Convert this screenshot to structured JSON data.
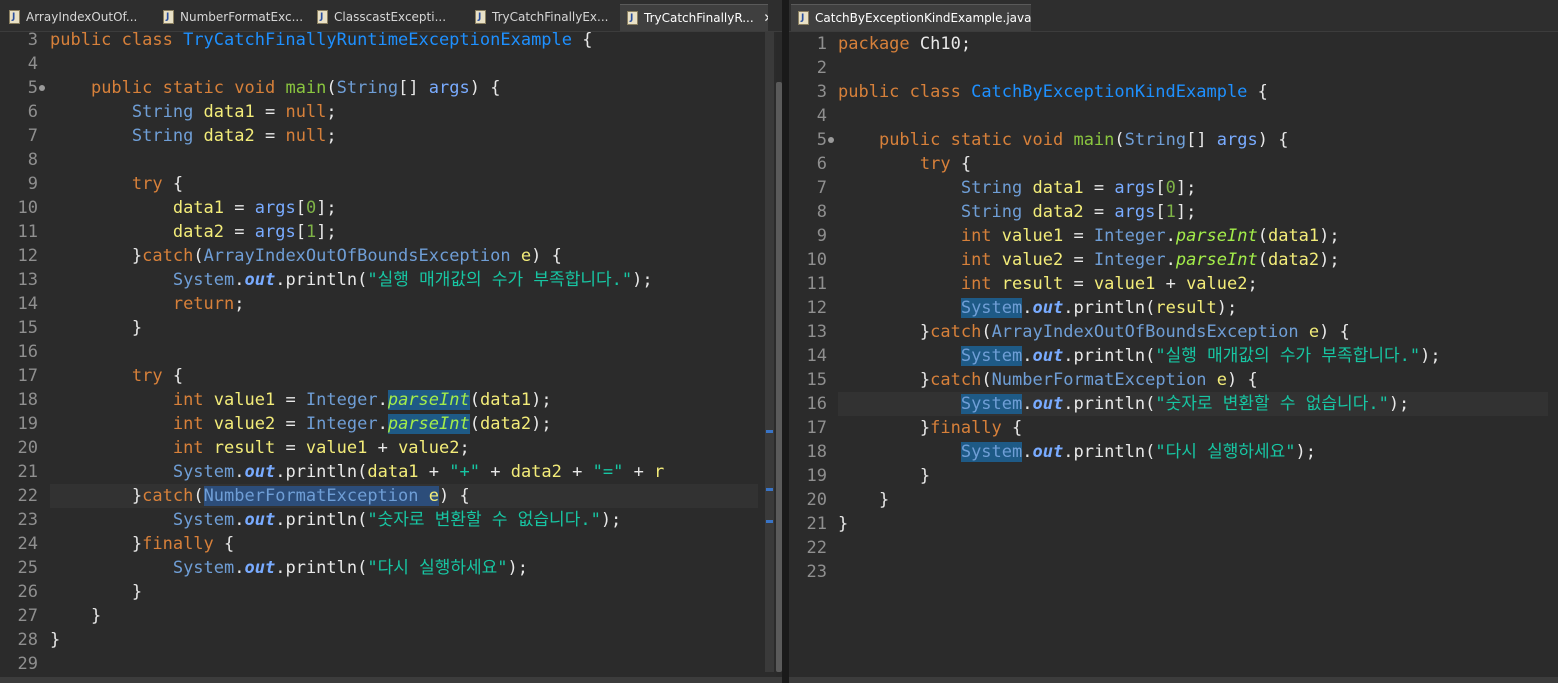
{
  "left_tabs": [
    {
      "label": "ArrayIndexOutOf...",
      "active": false
    },
    {
      "label": "NumberFormatExc...",
      "active": false
    },
    {
      "label": "ClasscastExcepti...",
      "active": false
    },
    {
      "label": "TryCatchFinallyEx...",
      "active": false
    },
    {
      "label": "TryCatchFinallyR...",
      "active": true,
      "close": "✕"
    }
  ],
  "right_tabs": [
    {
      "label": "CatchByExceptionKindExample.java",
      "active": true,
      "close": "✕"
    }
  ],
  "left_editor": {
    "current_line": 22,
    "lines": [
      {
        "n": "3",
        "t": [
          [
            "kw",
            "public "
          ],
          [
            "kw",
            "class "
          ],
          [
            "cls",
            "TryCatchFinallyRuntimeExceptionExample"
          ],
          [
            "op",
            " {"
          ]
        ]
      },
      {
        "n": "4",
        "t": []
      },
      {
        "n": "5",
        "fold": true,
        "t": [
          [
            "op",
            "    "
          ],
          [
            "kw",
            "public "
          ],
          [
            "kw",
            "static "
          ],
          [
            "kw",
            "void "
          ],
          [
            "fn",
            "main"
          ],
          [
            "op",
            "("
          ],
          [
            "ty",
            "String"
          ],
          [
            "op",
            "[] "
          ],
          [
            "st",
            "args"
          ],
          [
            "op",
            ") {"
          ]
        ]
      },
      {
        "n": "6",
        "t": [
          [
            "op",
            "        "
          ],
          [
            "ty",
            "String "
          ],
          [
            "var",
            "data1"
          ],
          [
            "op",
            " = "
          ],
          [
            "kw",
            "null"
          ],
          [
            "op",
            ";"
          ]
        ]
      },
      {
        "n": "7",
        "t": [
          [
            "op",
            "        "
          ],
          [
            "ty",
            "String "
          ],
          [
            "var",
            "data2"
          ],
          [
            "op",
            " = "
          ],
          [
            "kw",
            "null"
          ],
          [
            "op",
            ";"
          ]
        ]
      },
      {
        "n": "8",
        "t": []
      },
      {
        "n": "9",
        "t": [
          [
            "op",
            "        "
          ],
          [
            "kw",
            "try"
          ],
          [
            "op",
            " {"
          ]
        ]
      },
      {
        "n": "10",
        "t": [
          [
            "op",
            "            "
          ],
          [
            "var",
            "data1"
          ],
          [
            "op",
            " = "
          ],
          [
            "st",
            "args"
          ],
          [
            "op",
            "["
          ],
          [
            "num",
            "0"
          ],
          [
            "op",
            "];"
          ]
        ]
      },
      {
        "n": "11",
        "t": [
          [
            "op",
            "            "
          ],
          [
            "var",
            "data2"
          ],
          [
            "op",
            " = "
          ],
          [
            "st",
            "args"
          ],
          [
            "op",
            "["
          ],
          [
            "num",
            "1"
          ],
          [
            "op",
            "];"
          ]
        ]
      },
      {
        "n": "12",
        "t": [
          [
            "op",
            "        }"
          ],
          [
            "kw",
            "catch"
          ],
          [
            "op",
            "("
          ],
          [
            "ty",
            "ArrayIndexOutOfBoundsException"
          ],
          [
            "op",
            " "
          ],
          [
            "var",
            "e"
          ],
          [
            "op",
            ") {"
          ]
        ]
      },
      {
        "n": "13",
        "t": [
          [
            "op",
            "            "
          ],
          [
            "ty",
            "System"
          ],
          [
            "op",
            "."
          ],
          [
            "si",
            "out"
          ],
          [
            "op",
            "."
          ],
          [
            "op",
            "println("
          ],
          [
            "str",
            "\"실행 매개값의 수가 부족합니다.\""
          ],
          [
            "op",
            ");"
          ]
        ]
      },
      {
        "n": "14",
        "t": [
          [
            "op",
            "            "
          ],
          [
            "kw",
            "return"
          ],
          [
            "op",
            ";"
          ]
        ]
      },
      {
        "n": "15",
        "t": [
          [
            "op",
            "        }"
          ]
        ]
      },
      {
        "n": "16",
        "t": []
      },
      {
        "n": "17",
        "t": [
          [
            "op",
            "        "
          ],
          [
            "kw",
            "try"
          ],
          [
            "op",
            " {"
          ]
        ]
      },
      {
        "n": "18",
        "t": [
          [
            "op",
            "            "
          ],
          [
            "kw",
            "int "
          ],
          [
            "var",
            "value1"
          ],
          [
            "op",
            " = "
          ],
          [
            "ty",
            "Integer"
          ],
          [
            "op",
            "."
          ],
          [
            "mcall mk",
            "parseInt"
          ],
          [
            "op",
            "("
          ],
          [
            "var",
            "data1"
          ],
          [
            "op",
            ");"
          ]
        ]
      },
      {
        "n": "19",
        "t": [
          [
            "op",
            "            "
          ],
          [
            "kw",
            "int "
          ],
          [
            "var",
            "value2"
          ],
          [
            "op",
            " = "
          ],
          [
            "ty",
            "Integer"
          ],
          [
            "op",
            "."
          ],
          [
            "mcall mk",
            "parseInt"
          ],
          [
            "op",
            "("
          ],
          [
            "var",
            "data2"
          ],
          [
            "op",
            ");"
          ]
        ]
      },
      {
        "n": "20",
        "t": [
          [
            "op",
            "            "
          ],
          [
            "kw",
            "int "
          ],
          [
            "var",
            "result"
          ],
          [
            "op",
            " = "
          ],
          [
            "var",
            "value1"
          ],
          [
            "op",
            " + "
          ],
          [
            "var",
            "value2"
          ],
          [
            "op",
            ";"
          ]
        ]
      },
      {
        "n": "21",
        "t": [
          [
            "op",
            "            "
          ],
          [
            "ty",
            "System"
          ],
          [
            "op",
            "."
          ],
          [
            "si",
            "out"
          ],
          [
            "op",
            "."
          ],
          [
            "op",
            "println("
          ],
          [
            "var",
            "data1"
          ],
          [
            "op",
            " + "
          ],
          [
            "str",
            "\"+\""
          ],
          [
            "op",
            " + "
          ],
          [
            "var",
            "data2"
          ],
          [
            "op",
            " + "
          ],
          [
            "str",
            "\"=\""
          ],
          [
            "op",
            " + "
          ],
          [
            "var",
            "r"
          ]
        ]
      },
      {
        "n": "22",
        "t": [
          [
            "op",
            "        }"
          ],
          [
            "kw",
            "catch"
          ],
          [
            "op",
            "("
          ],
          [
            "ty mk2",
            "NumberFormatException"
          ],
          [
            "op mk2",
            " "
          ],
          [
            "var mk2",
            "e"
          ],
          [
            "op",
            ") {"
          ]
        ]
      },
      {
        "n": "23",
        "t": [
          [
            "op",
            "            "
          ],
          [
            "ty",
            "System"
          ],
          [
            "op",
            "."
          ],
          [
            "si",
            "out"
          ],
          [
            "op",
            "."
          ],
          [
            "op",
            "println("
          ],
          [
            "str",
            "\"숫자로 변환할 수 없습니다.\""
          ],
          [
            "op",
            ");"
          ]
        ]
      },
      {
        "n": "24",
        "t": [
          [
            "op",
            "        }"
          ],
          [
            "kw",
            "finally"
          ],
          [
            "op",
            " {"
          ]
        ]
      },
      {
        "n": "25",
        "t": [
          [
            "op",
            "            "
          ],
          [
            "ty",
            "System"
          ],
          [
            "op",
            "."
          ],
          [
            "si",
            "out"
          ],
          [
            "op",
            "."
          ],
          [
            "op",
            "println("
          ],
          [
            "str",
            "\"다시 실행하세요\""
          ],
          [
            "op",
            ");"
          ]
        ]
      },
      {
        "n": "26",
        "t": [
          [
            "op",
            "        }"
          ]
        ]
      },
      {
        "n": "27",
        "t": [
          [
            "op",
            "    }"
          ]
        ]
      },
      {
        "n": "28",
        "t": [
          [
            "op",
            "}"
          ]
        ]
      },
      {
        "n": "29",
        "t": []
      }
    ]
  },
  "right_editor": {
    "current_line": 16,
    "lines": [
      {
        "n": "1",
        "t": [
          [
            "kw",
            "package "
          ],
          [
            "op",
            "Ch10;"
          ]
        ]
      },
      {
        "n": "2",
        "t": []
      },
      {
        "n": "3",
        "t": [
          [
            "kw",
            "public "
          ],
          [
            "kw",
            "class "
          ],
          [
            "cls",
            "CatchByExceptionKindExample"
          ],
          [
            "op",
            " {"
          ]
        ]
      },
      {
        "n": "4",
        "t": []
      },
      {
        "n": "5",
        "fold": true,
        "t": [
          [
            "op",
            "    "
          ],
          [
            "kw",
            "public "
          ],
          [
            "kw",
            "static "
          ],
          [
            "kw",
            "void "
          ],
          [
            "fn",
            "main"
          ],
          [
            "op",
            "("
          ],
          [
            "ty",
            "String"
          ],
          [
            "op",
            "[] "
          ],
          [
            "st",
            "args"
          ],
          [
            "op",
            ") {"
          ]
        ]
      },
      {
        "n": "6",
        "t": [
          [
            "op",
            "        "
          ],
          [
            "kw",
            "try"
          ],
          [
            "op",
            " {"
          ]
        ]
      },
      {
        "n": "7",
        "t": [
          [
            "op",
            "            "
          ],
          [
            "ty",
            "String "
          ],
          [
            "var",
            "data1"
          ],
          [
            "op",
            " = "
          ],
          [
            "st",
            "args"
          ],
          [
            "op",
            "["
          ],
          [
            "num",
            "0"
          ],
          [
            "op",
            "];"
          ]
        ]
      },
      {
        "n": "8",
        "t": [
          [
            "op",
            "            "
          ],
          [
            "ty",
            "String "
          ],
          [
            "var",
            "data2"
          ],
          [
            "op",
            " = "
          ],
          [
            "st",
            "args"
          ],
          [
            "op",
            "["
          ],
          [
            "num",
            "1"
          ],
          [
            "op",
            "];"
          ]
        ]
      },
      {
        "n": "9",
        "t": [
          [
            "op",
            "            "
          ],
          [
            "kw",
            "int "
          ],
          [
            "var",
            "value1"
          ],
          [
            "op",
            " = "
          ],
          [
            "ty",
            "Integer"
          ],
          [
            "op",
            "."
          ],
          [
            "mcall",
            "parseInt"
          ],
          [
            "op",
            "("
          ],
          [
            "var",
            "data1"
          ],
          [
            "op",
            ");"
          ]
        ]
      },
      {
        "n": "10",
        "t": [
          [
            "op",
            "            "
          ],
          [
            "kw",
            "int "
          ],
          [
            "var",
            "value2"
          ],
          [
            "op",
            " = "
          ],
          [
            "ty",
            "Integer"
          ],
          [
            "op",
            "."
          ],
          [
            "mcall",
            "parseInt"
          ],
          [
            "op",
            "("
          ],
          [
            "var",
            "data2"
          ],
          [
            "op",
            ");"
          ]
        ]
      },
      {
        "n": "11",
        "t": [
          [
            "op",
            "            "
          ],
          [
            "kw",
            "int "
          ],
          [
            "var",
            "result"
          ],
          [
            "op",
            " = "
          ],
          [
            "var",
            "value1"
          ],
          [
            "op",
            " + "
          ],
          [
            "var",
            "value2"
          ],
          [
            "op",
            ";"
          ]
        ]
      },
      {
        "n": "12",
        "t": [
          [
            "op",
            "            "
          ],
          [
            "ty mk",
            "System"
          ],
          [
            "op",
            "."
          ],
          [
            "si",
            "out"
          ],
          [
            "op",
            "."
          ],
          [
            "op",
            "println("
          ],
          [
            "var",
            "result"
          ],
          [
            "op",
            ");"
          ]
        ]
      },
      {
        "n": "13",
        "t": [
          [
            "op",
            "        }"
          ],
          [
            "kw",
            "catch"
          ],
          [
            "op",
            "("
          ],
          [
            "ty",
            "ArrayIndexOutOfBoundsException"
          ],
          [
            "op",
            " "
          ],
          [
            "var",
            "e"
          ],
          [
            "op",
            ") {"
          ]
        ]
      },
      {
        "n": "14",
        "t": [
          [
            "op",
            "            "
          ],
          [
            "ty mk",
            "System"
          ],
          [
            "op",
            "."
          ],
          [
            "si",
            "out"
          ],
          [
            "op",
            "."
          ],
          [
            "op",
            "println("
          ],
          [
            "str",
            "\"실행 매개값의 수가 부족합니다.\""
          ],
          [
            "op",
            ");"
          ]
        ]
      },
      {
        "n": "15",
        "t": [
          [
            "op",
            "        }"
          ],
          [
            "kw",
            "catch"
          ],
          [
            "op",
            "("
          ],
          [
            "ty",
            "NumberFormatException"
          ],
          [
            "op",
            " "
          ],
          [
            "var",
            "e"
          ],
          [
            "op",
            ") {"
          ]
        ]
      },
      {
        "n": "16",
        "t": [
          [
            "op",
            "            "
          ],
          [
            "ty mk",
            "System"
          ],
          [
            "op",
            "."
          ],
          [
            "si",
            "out"
          ],
          [
            "op",
            "."
          ],
          [
            "op",
            "println("
          ],
          [
            "str",
            "\"숫자로 변환할 수 없습니다.\""
          ],
          [
            "op",
            ");"
          ]
        ]
      },
      {
        "n": "17",
        "t": [
          [
            "op",
            "        }"
          ],
          [
            "kw",
            "finally"
          ],
          [
            "op",
            " {"
          ]
        ]
      },
      {
        "n": "18",
        "t": [
          [
            "op",
            "            "
          ],
          [
            "ty mk",
            "System"
          ],
          [
            "op",
            "."
          ],
          [
            "si",
            "out"
          ],
          [
            "op",
            "."
          ],
          [
            "op",
            "println("
          ],
          [
            "str",
            "\"다시 실행하세요\""
          ],
          [
            "op",
            ");"
          ]
        ]
      },
      {
        "n": "19",
        "t": [
          [
            "op",
            "        }"
          ]
        ]
      },
      {
        "n": "20",
        "t": [
          [
            "op",
            "    }"
          ]
        ]
      },
      {
        "n": "21",
        "t": [
          [
            "op",
            "}"
          ]
        ]
      },
      {
        "n": "22",
        "t": []
      },
      {
        "n": "23",
        "t": []
      }
    ]
  },
  "icons": {
    "file": "java-file-icon",
    "close": "close-icon",
    "fold": "fold-collapse-icon"
  }
}
